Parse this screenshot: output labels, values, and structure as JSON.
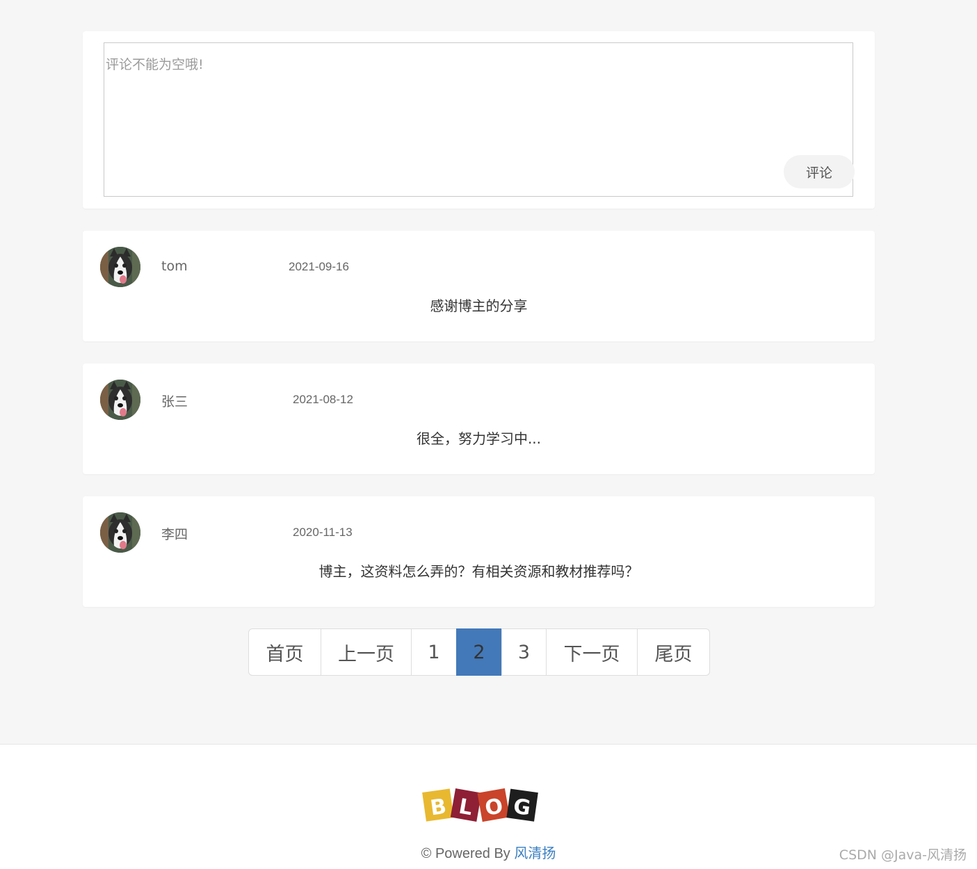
{
  "compose": {
    "placeholder": "评论不能为空哦!",
    "submit_label": "评论"
  },
  "comments": [
    {
      "author": "tom",
      "date": "2021-09-16",
      "content": "感谢博主的分享"
    },
    {
      "author": "张三",
      "date": "2021-08-12",
      "content": "很全，努力学习中..."
    },
    {
      "author": "李四",
      "date": "2020-11-13",
      "content": "博主，这资料怎么弄的？有相关资源和教材推荐吗？"
    }
  ],
  "pagination": {
    "first": "首页",
    "prev": "上一页",
    "pages": [
      "1",
      "2",
      "3"
    ],
    "current": "2",
    "next": "下一页",
    "last": "尾页",
    "active_color": "#4379b9"
  },
  "footer": {
    "logo_letters": [
      "B",
      "L",
      "O",
      "G"
    ],
    "powered_prefix": "© Powered By",
    "author_link": "风清扬",
    "link_color": "#3a7fc1"
  },
  "watermark": "CSDN @Java-风清扬"
}
